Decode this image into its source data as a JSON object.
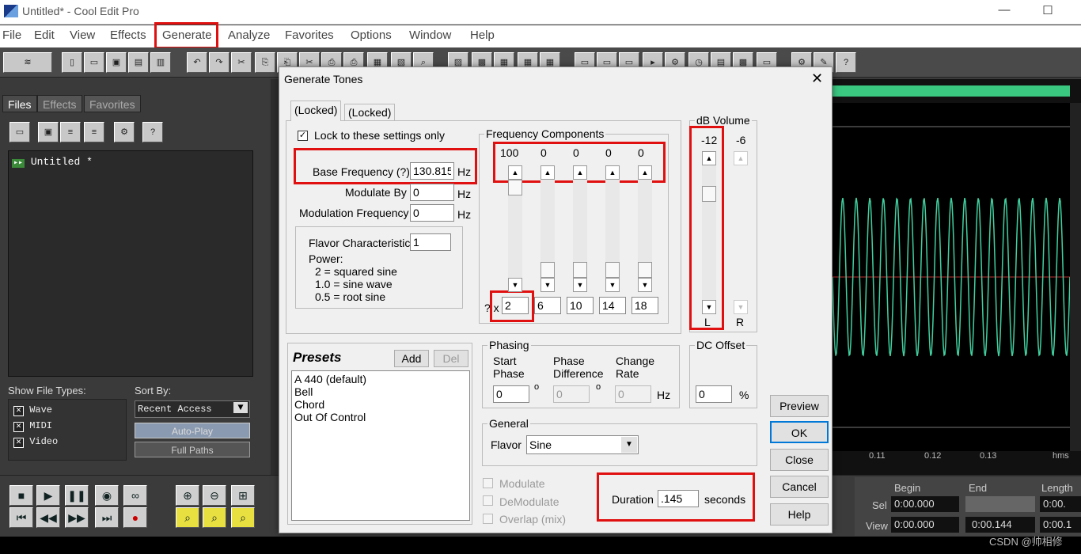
{
  "window": {
    "title": "Untitled* - Cool Edit Pro"
  },
  "menu": [
    "File",
    "Edit",
    "View",
    "Effects",
    "Generate",
    "Analyze",
    "Favorites",
    "Options",
    "Window",
    "Help"
  ],
  "left_panel": {
    "tabs": [
      "Files",
      "Effects",
      "Favorites"
    ],
    "file_item": "Untitled *",
    "show_file_types_label": "Show File Types:",
    "sort_by_label": "Sort By:",
    "file_types": [
      "Wave",
      "MIDI",
      "Video"
    ],
    "sort_value": "Recent Access",
    "auto_play": "Auto-Play",
    "full_paths": "Full Paths"
  },
  "wave_panel": {
    "ticks": [
      "0.11",
      "0.12",
      "0.13",
      "hms"
    ]
  },
  "selection": {
    "headers": [
      "Begin",
      "End",
      "Length"
    ],
    "sel_label": "Sel",
    "view_label": "View",
    "sel_begin": "0:00.000",
    "sel_end": "",
    "sel_length": "0:00.",
    "view_begin": "0:00.000",
    "view_end": "0:00.144",
    "view_length": "0:00.1"
  },
  "watermark": "CSDN @帅相修",
  "dialog": {
    "title": "Generate Tones",
    "tabs": [
      "(Locked)",
      "(Locked)"
    ],
    "lock_label": "Lock to these settings only",
    "base_freq_label": "Base Frequency (?)",
    "base_freq_value": "130.815",
    "hz": "Hz",
    "modulate_by_label": "Modulate By",
    "modulate_by_value": "0",
    "mod_freq_label": "Modulation Frequency",
    "mod_freq_value": "0",
    "flavor_char_label": "Flavor Characteristic",
    "flavor_char_value": "1",
    "power_label": "Power:",
    "power_lines": [
      "2 = squared sine",
      "1.0 = sine wave",
      "0.5 = root sine"
    ],
    "freq_components_label": "Frequency Components",
    "freq_levels": [
      "100",
      "0",
      "0",
      "0",
      "0"
    ],
    "freq_levels_fraction": [
      1.0,
      0,
      0,
      0,
      0
    ],
    "multipliers": [
      "2",
      "6",
      "10",
      "14",
      "18"
    ],
    "mult_prefix": "? x",
    "db_volume_label": "dB Volume",
    "db_left": "-12",
    "db_right": "-6",
    "db_l": "L",
    "db_r": "R",
    "presets_label": "Presets",
    "add": "Add",
    "del": "Del",
    "presets": [
      "A 440 (default)",
      "Bell",
      "Chord",
      "Out Of Control"
    ],
    "phasing_label": "Phasing",
    "start_phase_label": "Start\nPhase",
    "phase_diff_label": "Phase\nDifference",
    "change_rate_label": "Change\nRate",
    "start_phase": "0",
    "phase_diff": "0",
    "change_rate": "0",
    "degree": "o",
    "dc_offset_label": "DC Offset",
    "dc_offset": "0",
    "percent": "%",
    "general_label": "General",
    "flavor_label": "Flavor",
    "flavor_value": "Sine",
    "modulate": "Modulate",
    "demodulate": "DeModulate",
    "overlap": "Overlap (mix)",
    "duration_label": "Duration",
    "duration_value": ".145",
    "seconds": "seconds",
    "buttons": [
      "Preview",
      "OK",
      "Close",
      "Cancel",
      "Help"
    ]
  }
}
